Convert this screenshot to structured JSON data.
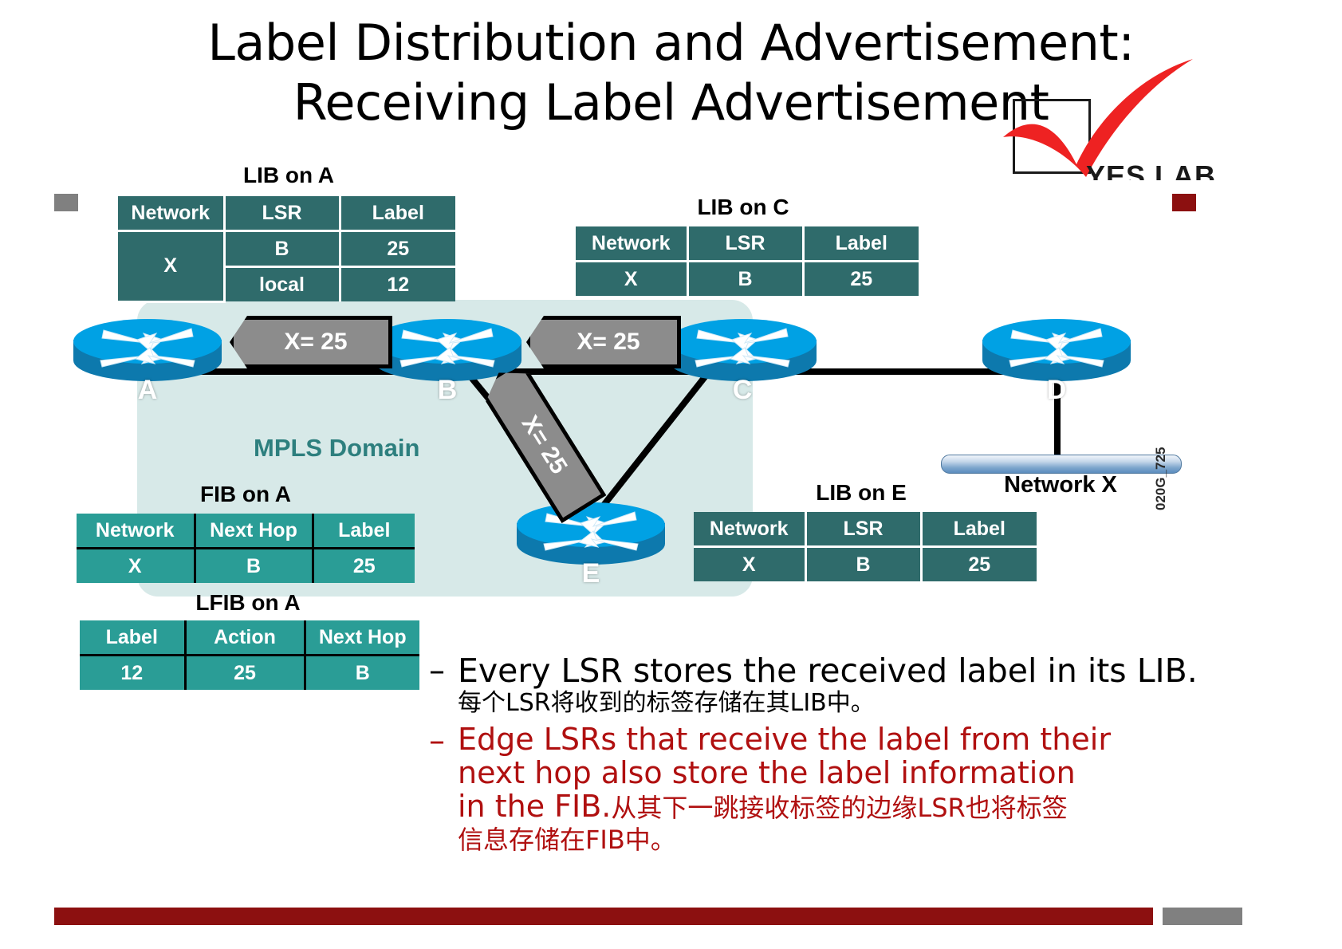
{
  "slide": {
    "title_line1": "Label Distribution and Advertisement:",
    "title_line2": "Receiving Label Advertisement",
    "side_code": "020G_725",
    "mpls_domain_label": "MPLS Domain",
    "network_bar_label": "Network X"
  },
  "logo": {
    "name": "YES LAB",
    "check_color": "#ee2222",
    "box_color": "#1a1a1a"
  },
  "colors": {
    "table_dark": "#2f6b6b",
    "table_light": "#2a9d96",
    "domain_fill": "#d7e9e8",
    "domain_text": "#2d7f7e",
    "router_top": "#00a1e4",
    "router_side": "#0d79ad",
    "tag_fill": "#8c8c8c",
    "accent_red": "#8c1010",
    "bullet_red": "#b01010",
    "accent_gray": "#808080"
  },
  "tables": {
    "lib_a": {
      "caption": "LIB on A",
      "headers": [
        "Network",
        "LSR",
        "Label"
      ],
      "rows": [
        [
          "X",
          "B",
          "25"
        ],
        [
          "",
          "local",
          "12"
        ]
      ]
    },
    "lib_c": {
      "caption": "LIB on C",
      "headers": [
        "Network",
        "LSR",
        "Label"
      ],
      "rows": [
        [
          "X",
          "B",
          "25"
        ]
      ]
    },
    "lib_e": {
      "caption": "LIB on E",
      "headers": [
        "Network",
        "LSR",
        "Label"
      ],
      "rows": [
        [
          "X",
          "B",
          "25"
        ]
      ]
    },
    "fib_a": {
      "caption": "FIB on A",
      "headers": [
        "Network",
        "Next Hop",
        "Label"
      ],
      "rows": [
        [
          "X",
          "B",
          "25"
        ]
      ]
    },
    "lfib_a": {
      "caption": "LFIB on A",
      "headers": [
        "Label",
        "Action",
        "Next Hop"
      ],
      "rows": [
        [
          "12",
          "25",
          "B"
        ]
      ]
    }
  },
  "routers": [
    {
      "id": "a",
      "label": "A"
    },
    {
      "id": "b",
      "label": "B"
    },
    {
      "id": "c",
      "label": "C"
    },
    {
      "id": "d",
      "label": "D"
    },
    {
      "id": "e",
      "label": "E"
    }
  ],
  "tags": [
    {
      "id": "ab",
      "text": "X= 25"
    },
    {
      "id": "bc",
      "text": "X= 25"
    },
    {
      "id": "be",
      "text": "X= 25"
    }
  ],
  "bullets": {
    "dash": "–",
    "item1": {
      "en": "Every LSR stores the received label in its  LIB.",
      "cn": "每个LSR将收到的标签存储在其LIB中。"
    },
    "item2": {
      "en_line1": "Edge LSRs that receive the label from  their",
      "en_line2": "next hop also store the label  information",
      "en_line3": "in the FIB.",
      "cn_line3": "从其下一跳接收标签的边缘LSR也将标签",
      "cn_line4": "信息存储在FIB中。"
    }
  }
}
